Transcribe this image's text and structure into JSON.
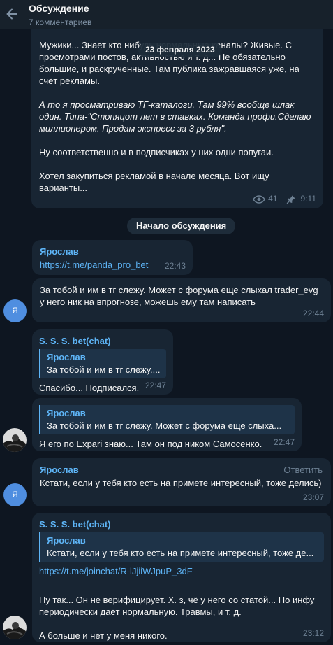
{
  "header": {
    "title": "Обсуждение",
    "subtitle": "7 комментариев"
  },
  "date_separator": "23 февраля 2023",
  "post": {
    "paragraphs": [
      "Мужики... Знает кто нибудь нормальные каналы? Живые. С просмотрами постов, активностью и т. д... Не обязательно большие, и раскрученные. Там публика зажравшаяся уже, на счёт рекламы.",
      "А то я просматриваю ТГ-каталоги. Там 99% вообще шлак один. Типа-\"Стопяцот лет в ставках. Команда профи.Сделаю миллионером. Продам экспресс за 3 рубля\".",
      "Ну соответственно и в подписчиках у них одни попугаи.",
      "Хотел закупиться рекламой в начале месяца. Вот ищу варианты..."
    ],
    "views": "41",
    "time": "9:11"
  },
  "discussion_start": "Начало обсуждения",
  "messages": [
    {
      "sender": "Ярослав",
      "link": "https://t.me/panda_pro_bet",
      "time": "22:43"
    },
    {
      "avatar_letter": "Я",
      "text": "За тобой и им в тг слежу.  Может с форума еще слыхал trader_evg у него ник на впрогнозе, можешь ему там написать",
      "time": "22:44"
    },
    {
      "sender": "S. S. S. bet(chat)",
      "quote_name": "Ярослав",
      "quote_text": "За тобой и им в тг слежу....",
      "text": "Спасибо... Подписался.",
      "time": "22:47"
    },
    {
      "quote_name": "Ярослав",
      "quote_text": "За тобой и им в тг слежу.  Может с форума еще слыха...",
      "text": "Я его по Expari знаю... Там он под ником Самосенко.",
      "time": "22:47"
    },
    {
      "avatar_letter": "Я",
      "sender": "Ярослав",
      "reply_label": "Ответить",
      "text": "Кстати, если у тебя кто есть на примете интересный, тоже делись)",
      "time": "23:07"
    },
    {
      "sender": "S. S. S. bet(chat)",
      "quote_name": "Ярослав",
      "quote_text": "Кстати, если у тебя кто есть на примете интересный, тоже де...",
      "link": "https://t.me/joinchat/R-lJjiiWJpuP_3dF",
      "paragraphs": [
        "Ну так... Он не верифицирует. Х. з, чё у него со статой... Но инфу периодически даёт нормальную. Травмы, и т. д.",
        "А больше и нет у меня никого."
      ],
      "time": "23:12"
    }
  ]
}
